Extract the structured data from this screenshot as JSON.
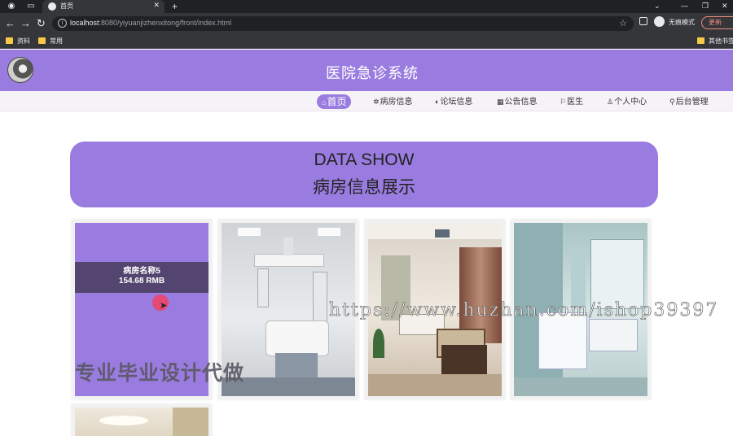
{
  "browser": {
    "tab_title": "首页",
    "url_host": "localhost",
    "url_path": ":8080/yiyuanjizhenxitong/front/index.html",
    "incognito_label": "无痕模式",
    "update_label": "更新",
    "bookmarks": [
      "资料",
      "常用"
    ],
    "other_bookmarks": "其他书签"
  },
  "site": {
    "title": "医院急诊系统"
  },
  "nav": [
    {
      "icon": "⌂",
      "label": "首页",
      "active": true
    },
    {
      "icon": "✲",
      "label": "病房信息"
    },
    {
      "icon": "◐",
      "label": "论坛信息"
    },
    {
      "icon": "▦",
      "label": "公告信息"
    },
    {
      "icon": "⚐",
      "label": "医生"
    },
    {
      "icon": "♙",
      "label": "个人中心"
    },
    {
      "icon": "⚲",
      "label": "后台管理"
    }
  ],
  "banner": {
    "title_en": "DATA SHOW",
    "title_cn": "病房信息展示"
  },
  "cards": [
    {
      "name": "病房名称5",
      "price": "154.68 RMB"
    }
  ],
  "watermarks": {
    "text_cn": "专业毕业设计代做",
    "text_url": "https://www.huzhan.com/ishop39397"
  },
  "colors": {
    "accent": "#9a7ce0",
    "browser_dark": "#35363a"
  }
}
